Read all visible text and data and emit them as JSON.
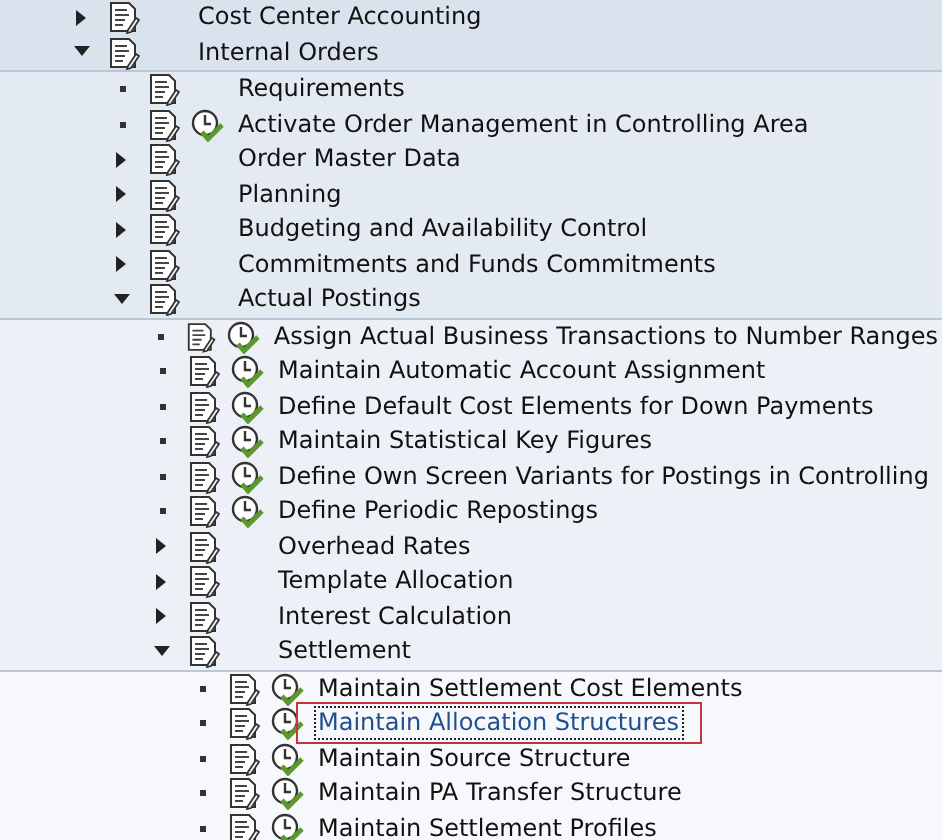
{
  "tree": [
    {
      "label": "Cost Center Accounting",
      "kind": "folder",
      "expanded": false,
      "activity": false,
      "selected": false
    },
    {
      "label": "Internal Orders",
      "kind": "folder",
      "expanded": true,
      "activity": false,
      "selected": false,
      "children": [
        {
          "label": "Requirements",
          "kind": "leaf",
          "activity": false,
          "selected": false
        },
        {
          "label": "Activate Order Management in Controlling Area",
          "kind": "leaf",
          "activity": true,
          "selected": false
        },
        {
          "label": "Order Master Data",
          "kind": "folder",
          "expanded": false,
          "activity": false,
          "selected": false
        },
        {
          "label": "Planning",
          "kind": "folder",
          "expanded": false,
          "activity": false,
          "selected": false
        },
        {
          "label": "Budgeting and Availability Control",
          "kind": "folder",
          "expanded": false,
          "activity": false,
          "selected": false
        },
        {
          "label": "Commitments and Funds Commitments",
          "kind": "folder",
          "expanded": false,
          "activity": false,
          "selected": false
        },
        {
          "label": "Actual Postings",
          "kind": "folder",
          "expanded": true,
          "activity": false,
          "selected": false,
          "children": [
            {
              "label": "Assign Actual Business Transactions to Number Ranges",
              "kind": "leaf",
              "activity": true,
              "selected": false
            },
            {
              "label": "Maintain Automatic Account Assignment",
              "kind": "leaf",
              "activity": true,
              "selected": false
            },
            {
              "label": "Define Default Cost Elements for Down Payments",
              "kind": "leaf",
              "activity": true,
              "selected": false
            },
            {
              "label": "Maintain Statistical Key Figures",
              "kind": "leaf",
              "activity": true,
              "selected": false
            },
            {
              "label": "Define Own Screen Variants for Postings in Controlling",
              "kind": "leaf",
              "activity": true,
              "selected": false
            },
            {
              "label": "Define Periodic Repostings",
              "kind": "leaf",
              "activity": true,
              "selected": false
            },
            {
              "label": "Overhead Rates",
              "kind": "folder",
              "expanded": false,
              "activity": false,
              "selected": false
            },
            {
              "label": "Template Allocation",
              "kind": "folder",
              "expanded": false,
              "activity": false,
              "selected": false
            },
            {
              "label": "Interest Calculation",
              "kind": "folder",
              "expanded": false,
              "activity": false,
              "selected": false
            },
            {
              "label": "Settlement",
              "kind": "folder",
              "expanded": true,
              "activity": false,
              "selected": false,
              "children": [
                {
                  "label": "Maintain Settlement Cost Elements",
                  "kind": "leaf",
                  "activity": true,
                  "selected": false
                },
                {
                  "label": "Maintain Allocation Structures",
                  "kind": "leaf",
                  "activity": true,
                  "selected": true,
                  "highlighted": true
                },
                {
                  "label": "Maintain Source Structure",
                  "kind": "leaf",
                  "activity": true,
                  "selected": false
                },
                {
                  "label": "Maintain PA Transfer Structure",
                  "kind": "leaf",
                  "activity": true,
                  "selected": false
                },
                {
                  "label": "Maintain Settlement Profiles",
                  "kind": "leaf",
                  "activity": true,
                  "selected": false
                }
              ]
            }
          ]
        }
      ]
    }
  ]
}
